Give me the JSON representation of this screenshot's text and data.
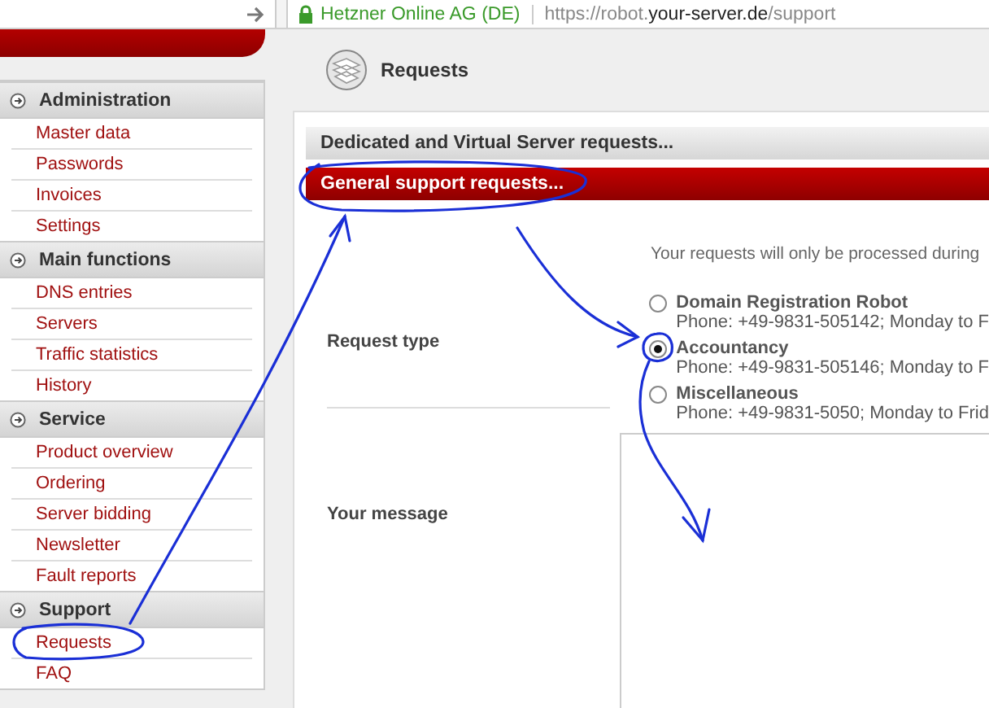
{
  "browser": {
    "site_owner": "Hetzner Online AG (DE)",
    "url_prefix": "https://robot.",
    "url_domain": "your-server.de",
    "url_path": "/support"
  },
  "sidebar": {
    "sections": [
      {
        "title": "Administration",
        "items": [
          "Master data",
          "Passwords",
          "Invoices",
          "Settings"
        ]
      },
      {
        "title": "Main functions",
        "items": [
          "DNS entries",
          "Servers",
          "Traffic statistics",
          "History"
        ]
      },
      {
        "title": "Service",
        "items": [
          "Product overview",
          "Ordering",
          "Server bidding",
          "Newsletter",
          "Fault reports"
        ]
      },
      {
        "title": "Support",
        "items": [
          "Requests",
          "FAQ"
        ]
      }
    ]
  },
  "page_title": "Requests",
  "accordions": [
    {
      "label": "Dedicated and Virtual Server requests...",
      "expanded": false
    },
    {
      "label": "General support requests...",
      "expanded": true
    }
  ],
  "notice": "Your requests will only be processed during",
  "request_type_label": "Request type",
  "options": [
    {
      "title": "Domain Registration Robot",
      "phone": "Phone: +49-9831-505142; Monday to F",
      "selected": false
    },
    {
      "title": "Accountancy",
      "phone": "Phone: +49-9831-505146; Monday to F",
      "selected": true
    },
    {
      "title": "Miscellaneous",
      "phone": "Phone: +49-9831-5050; Monday to Frid",
      "selected": false
    }
  ],
  "message_label": "Your message"
}
